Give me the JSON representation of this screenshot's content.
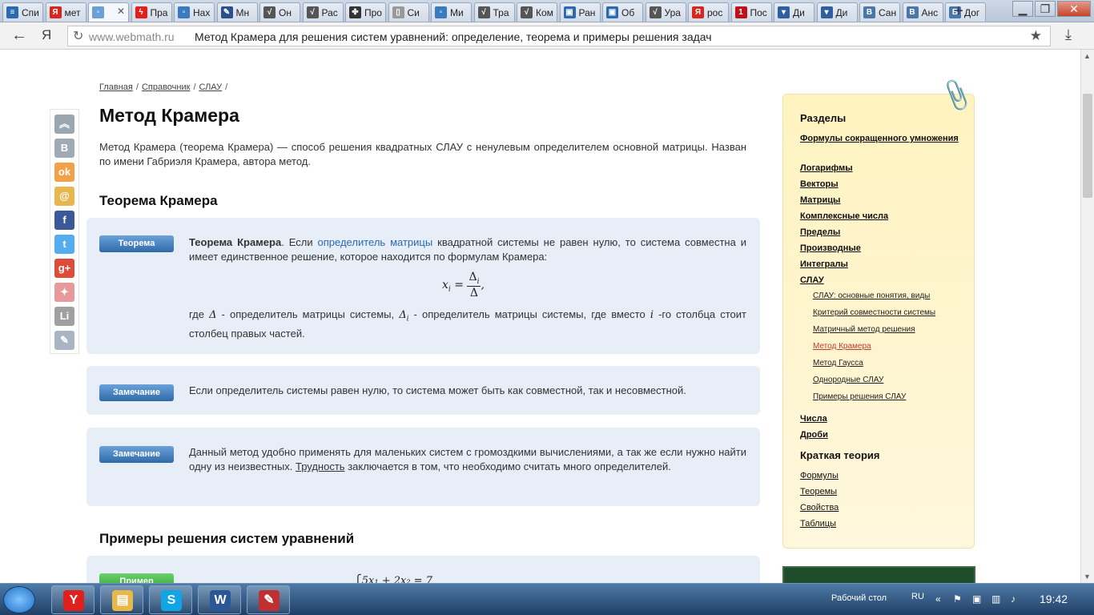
{
  "tabs": [
    {
      "label": "Спи",
      "color": "#2a6ab0",
      "glyph": "≡"
    },
    {
      "label": "мет",
      "color": "#d9261c",
      "glyph": "Я"
    },
    {
      "label": "",
      "color": "#6a9fd8",
      "glyph": "▫",
      "active": true
    },
    {
      "label": "Пра",
      "color": "#e0201c",
      "glyph": "ϟ"
    },
    {
      "label": "Нах",
      "color": "#3a7ac0",
      "glyph": "▫"
    },
    {
      "label": "Мн",
      "color": "#2b4f8a",
      "glyph": "✎"
    },
    {
      "label": "Он",
      "color": "#555",
      "glyph": "√"
    },
    {
      "label": "Рас",
      "color": "#555",
      "glyph": "√"
    },
    {
      "label": "Про",
      "color": "#333",
      "glyph": "✤"
    },
    {
      "label": "Си",
      "color": "#999",
      "glyph": "▯"
    },
    {
      "label": "Ми",
      "color": "#3a7ac0",
      "glyph": "▫"
    },
    {
      "label": "Тра",
      "color": "#555",
      "glyph": "√"
    },
    {
      "label": "Ком",
      "color": "#555",
      "glyph": "√"
    },
    {
      "label": "Ран",
      "color": "#2a6ab0",
      "glyph": "▣"
    },
    {
      "label": "Об",
      "color": "#2a6ab0",
      "glyph": "▣"
    },
    {
      "label": "Ура",
      "color": "#555",
      "glyph": "√"
    },
    {
      "label": "рос",
      "color": "#d9261c",
      "glyph": "Я"
    },
    {
      "label": "Пос",
      "color": "#c0111a",
      "glyph": "1"
    },
    {
      "label": "Ди",
      "color": "#2f5fa0",
      "glyph": "▾"
    },
    {
      "label": "Ди",
      "color": "#2f5fa0",
      "glyph": "▾"
    },
    {
      "label": "Сан",
      "color": "#4a76a8",
      "glyph": "B"
    },
    {
      "label": "Анс",
      "color": "#4a76a8",
      "glyph": "B"
    },
    {
      "label": "Дог",
      "color": "#4a76a8",
      "glyph": "B"
    }
  ],
  "browser": {
    "domain": "www.webmath.ru",
    "page_title": "Метод Крамера для решения систем уравнений: определение, теорема и примеры решения задач",
    "back": "←",
    "yandex": "Я",
    "reload": "C",
    "star": "★",
    "download": "⤓",
    "new_tab": "+"
  },
  "breadcrumb": [
    "Главная",
    "Справочник",
    "СЛАУ"
  ],
  "breadcrumb_sep": "/",
  "page": {
    "title": "Метод Крамера",
    "intro": "Метод Крамера (теорема Крамера) — способ решения квадратных СЛАУ с ненулевым определителем основной матрицы. Назван по имени Габриэля Крамера, автора метод.",
    "theorem_heading": "Теорема Крамера",
    "examples_heading": "Примеры решения систем уравнений"
  },
  "theorem_box": {
    "label": "Теорема",
    "bold_lead": "Теорема Крамера",
    "text_a": ". Если ",
    "link": "определитель матрицы",
    "text_b": " квадратной системы не равен нулю, то система совместна и имеет единственное решение, которое находится по формулам Крамера:",
    "formula_lhs": "x",
    "formula_sub": "i",
    "formula_num": "Δ",
    "formula_den": "Δ",
    "after_a": "где ",
    "after_delta": "Δ",
    "after_b": " - определитель матрицы системы, ",
    "after_delta_i": "Δ",
    "after_c": " - определитель матрицы системы, где вместо ",
    "after_i": "i",
    "after_d": " -го столбца стоит столбец правых частей."
  },
  "note1": {
    "label": "Замечание",
    "text": "Если определитель системы равен нулю, то система может быть как совместной, так и несовместной."
  },
  "note2": {
    "label": "Замечание",
    "text_a": "Данный метод удобно применять для маленьких систем с громоздкими вычислениями, а так же если нужно найти одну из неизвестных. ",
    "link": "Трудность",
    "text_b": " заключается в том, что необходимо считать много определителей."
  },
  "example": {
    "label": "Пример",
    "partial_formula": "⎧5x₁ + 2x₂ = 7"
  },
  "share_icons": [
    {
      "name": "scroll-top-icon",
      "glyph": "︽",
      "color": "#9aa6b2"
    },
    {
      "name": "vk-icon",
      "glyph": "В",
      "color": "#a0aab6"
    },
    {
      "name": "odnoklassniki-icon",
      "glyph": "ok",
      "color": "#f2a04a"
    },
    {
      "name": "mailru-icon",
      "glyph": "@",
      "color": "#e8b64e"
    },
    {
      "name": "facebook-icon",
      "glyph": "f",
      "color": "#3b5998"
    },
    {
      "name": "twitter-icon",
      "glyph": "t",
      "color": "#55acee"
    },
    {
      "name": "googleplus-icon",
      "glyph": "g+",
      "color": "#dd4b39"
    },
    {
      "name": "person-icon",
      "glyph": "✦",
      "color": "#e89a9a"
    },
    {
      "name": "liveinternet-icon",
      "glyph": "Li",
      "color": "#a0a0a0"
    },
    {
      "name": "clip-icon",
      "glyph": "✎",
      "color": "#a9b4c4"
    }
  ],
  "sidebar": {
    "heading": "Разделы",
    "items": [
      "Формулы сокращенного умножения",
      "Логарифмы",
      "Векторы",
      "Матрицы",
      "Комплексные числа",
      "Пределы",
      "Производные",
      "Интегралы",
      "СЛАУ"
    ],
    "subitems": [
      "СЛАУ: основные понятия, виды",
      "Критерий совместности системы",
      "Матричный метод решения",
      "Метод Крамера",
      "Метод Гаусса",
      "Однородные СЛАУ",
      "Примеры решения СЛАУ"
    ],
    "current_subitem": "Метод Крамера",
    "items2": [
      "Числа",
      "Дроби"
    ],
    "theory_heading": "Краткая теория",
    "theory_items": [
      "Формулы",
      "Теоремы",
      "Свойства",
      "Таблицы"
    ]
  },
  "taskbar": {
    "apps": [
      {
        "name": "yandex-browser-task",
        "glyph": "Y",
        "color": "#e0201c"
      },
      {
        "name": "explorer-task",
        "glyph": "▤",
        "color": "#e8b84a"
      },
      {
        "name": "skype-task",
        "glyph": "S",
        "color": "#12a5e6"
      },
      {
        "name": "word-task",
        "glyph": "W",
        "color": "#2b5797"
      },
      {
        "name": "paint-task",
        "glyph": "✎",
        "color": "#c03030"
      }
    ],
    "desktop_label": "Рабочий стол",
    "lang": "RU",
    "time": "19:42"
  },
  "colors": {
    "accent_blue": "#2a6ab0",
    "box_bg": "#e7eef8",
    "label_blue": "#2f6aa9",
    "sidebar_bg": "#fef3c6",
    "current_red": "#c0392b"
  }
}
